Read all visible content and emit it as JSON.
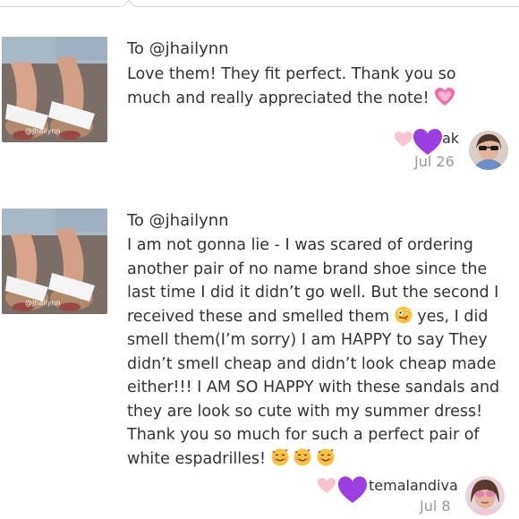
{
  "reviews": [
    {
      "to": "To @jhailynn",
      "text": "Love them! They fit perfect. Thank you so much and really appreciated the note!",
      "username": "ak",
      "date": "Jul 26",
      "watermark": "@Jhailynn"
    },
    {
      "to": "To @jhailynn",
      "text_before_emoji": "I am not gonna lie - I was scared of ordering another pair of no name brand shoe since the last time I did it didn’t go well. But the second I received these and smelled them",
      "text_after_emoji": "yes, I did smell them(I’m sorry) I am HAPPY to say They didn’t smell cheap and didn’t look cheap made either!!! I AM SO HAPPY with these sandals and they are look so cute with my summer dress! Thank you so much for such a perfect pair of white espadrilles!",
      "username": "temalandiva",
      "date": "Jul 8",
      "watermark": "@Jhailynn"
    }
  ],
  "icons": {
    "note_heart": "sparkling-heart-icon",
    "tongue": "zany-face-emoji",
    "love_face": "smiling-face-with-hearts-emoji",
    "like_light": "light-pink-heart-icon",
    "like_purple": "purple-heart-icon"
  },
  "colors": {
    "purple_heart": "#9b3fe0",
    "pink_heart": "#f9c3d0",
    "date_gray": "#9a9a9a"
  }
}
